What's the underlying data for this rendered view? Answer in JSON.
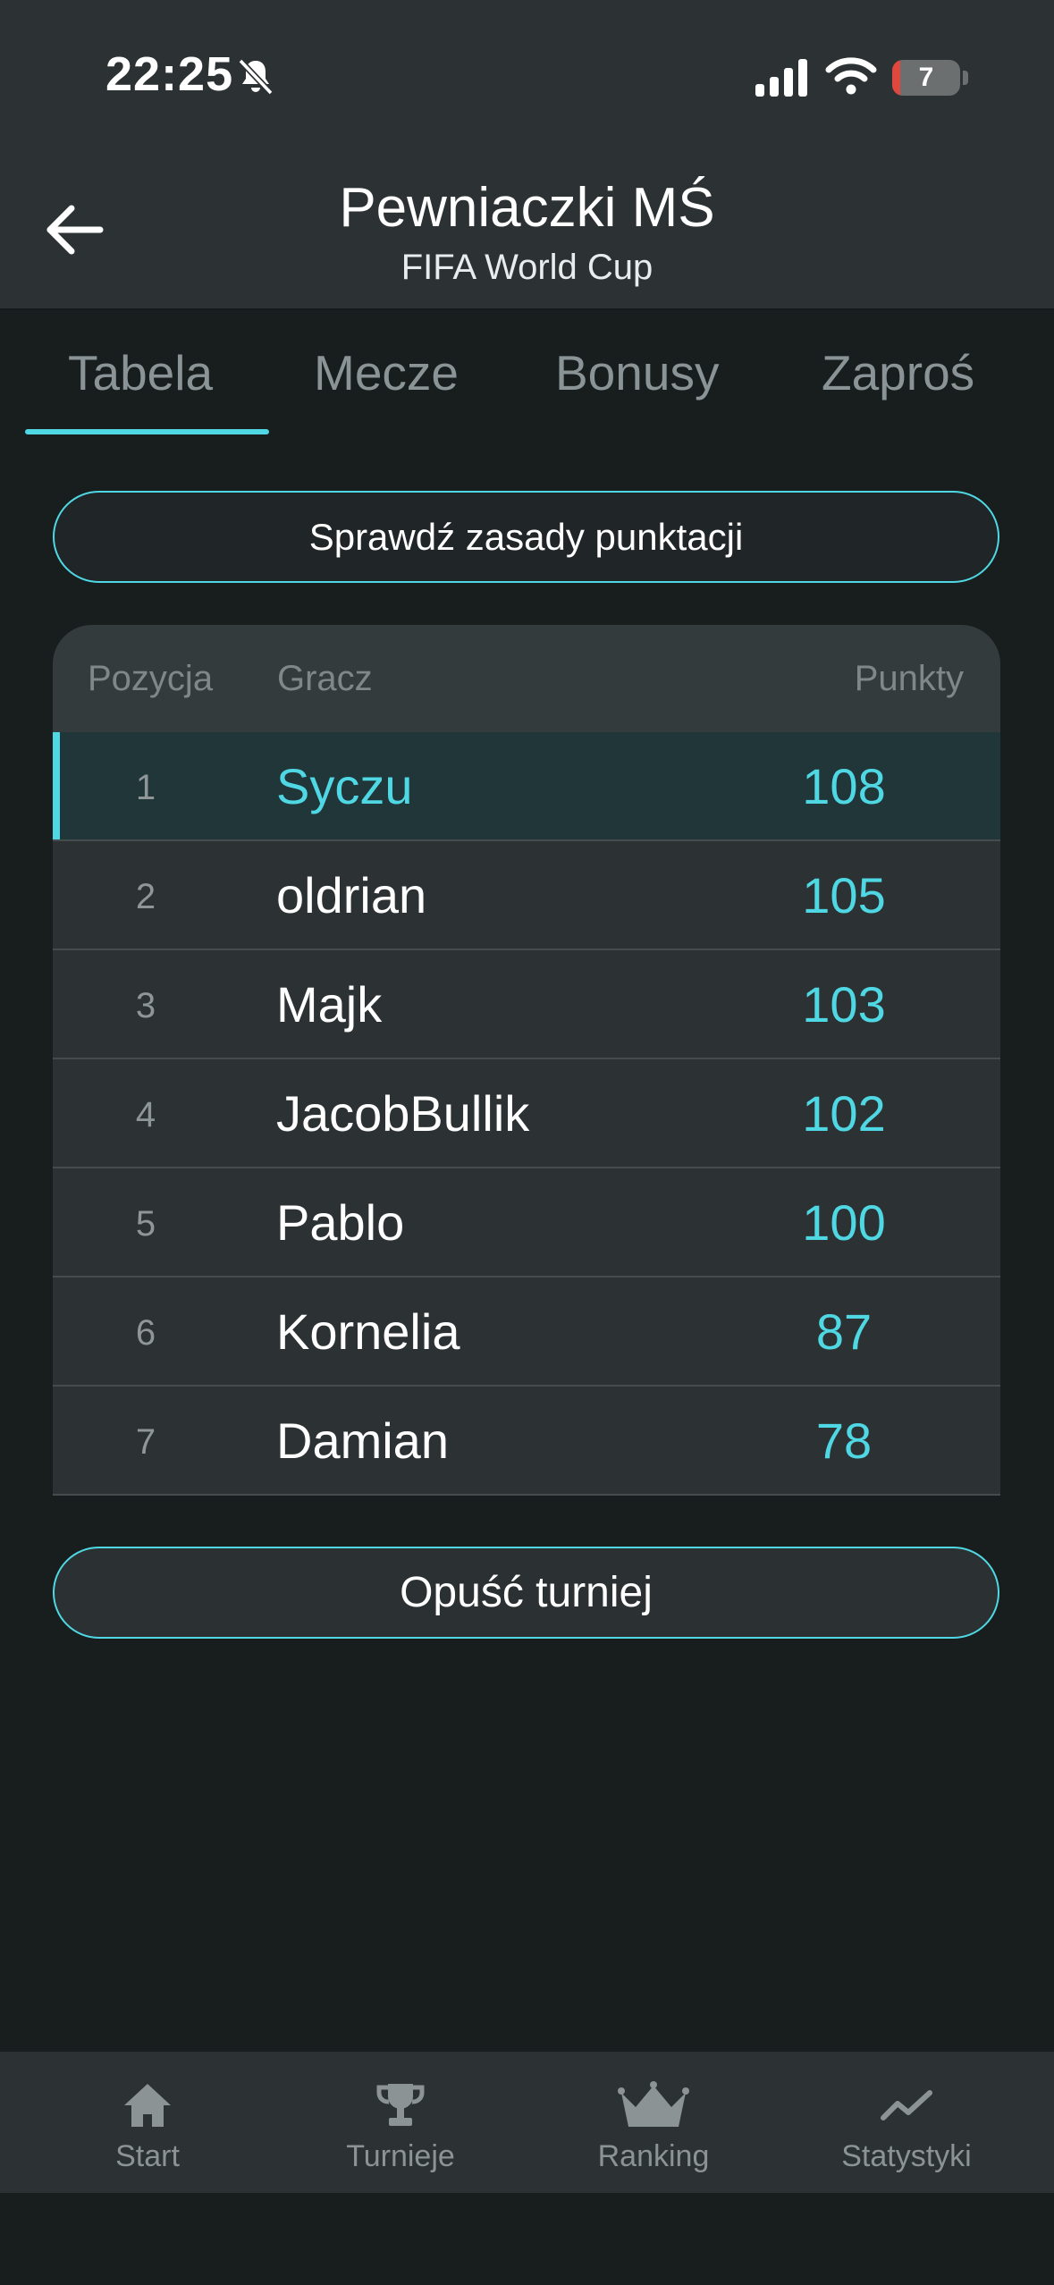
{
  "status_bar": {
    "time": "22:25",
    "battery": "7",
    "icons": [
      "bell-muted-icon",
      "cellular-signal-icon",
      "wifi-icon",
      "battery-icon"
    ]
  },
  "header": {
    "title": "Pewniaczki MŚ",
    "subtitle": "FIFA World Cup",
    "back_icon": "arrow-left-icon"
  },
  "tabs": [
    {
      "label": "Tabela",
      "active": true
    },
    {
      "label": "Mecze",
      "active": false
    },
    {
      "label": "Bonusy",
      "active": false
    },
    {
      "label": "Zaproś",
      "active": false
    }
  ],
  "rules_button": "Sprawdź zasady punktacji",
  "table": {
    "columns": [
      "Pozycja",
      "Gracz",
      "Punkty"
    ],
    "rows": [
      {
        "position": "1",
        "player": "Syczu",
        "points": "108"
      },
      {
        "position": "2",
        "player": "oldrian",
        "points": "105"
      },
      {
        "position": "3",
        "player": "Majk",
        "points": "103"
      },
      {
        "position": "4",
        "player": "JacobBullik",
        "points": "102"
      },
      {
        "position": "5",
        "player": "Pablo",
        "points": "100"
      },
      {
        "position": "6",
        "player": "Kornelia",
        "points": "87"
      },
      {
        "position": "7",
        "player": "Damian",
        "points": "78"
      }
    ]
  },
  "leave_button": "Opuść turniej",
  "bottom_nav": [
    {
      "label": "Start",
      "icon": "home-icon"
    },
    {
      "label": "Turnieje",
      "icon": "trophy-icon"
    },
    {
      "label": "Ranking",
      "icon": "crown-icon"
    },
    {
      "label": "Statystyki",
      "icon": "trend-chart-icon"
    }
  ],
  "colors": {
    "accent": "#4fd8e3",
    "background": "#181d1e",
    "surface": "#2c3233",
    "highlight_row": "#203639"
  }
}
